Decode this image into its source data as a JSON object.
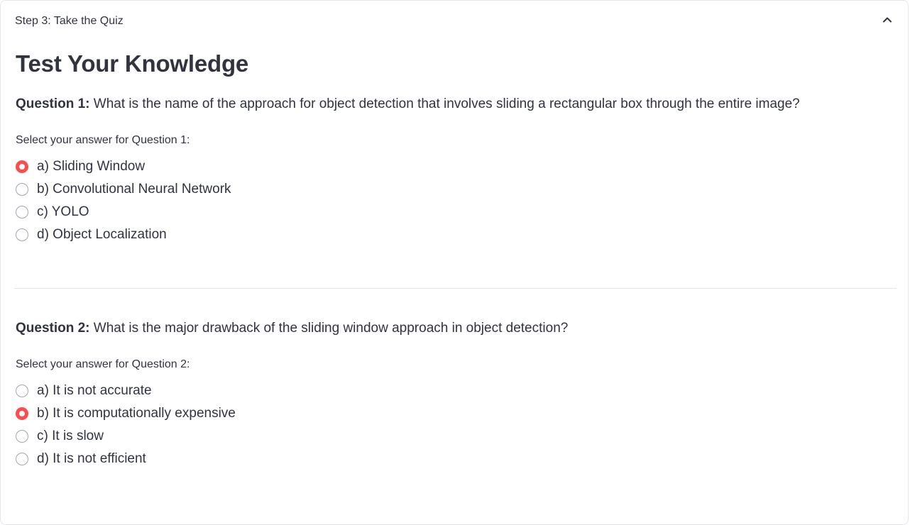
{
  "expander": {
    "title": "Step 3: Take the Quiz"
  },
  "page_title": "Test Your Knowledge",
  "questions": [
    {
      "label": "Question 1:",
      "text": " What is the name of the approach for object detection that involves sliding a rectangular box through the entire image?",
      "prompt": "Select your answer for Question 1:",
      "options": [
        {
          "text": "a) Sliding Window",
          "selected": true
        },
        {
          "text": "b) Convolutional Neural Network",
          "selected": false
        },
        {
          "text": "c) YOLO",
          "selected": false
        },
        {
          "text": "d) Object Localization",
          "selected": false
        }
      ]
    },
    {
      "label": "Question 2:",
      "text": " What is the major drawback of the sliding window approach in object detection?",
      "prompt": "Select your answer for Question 2:",
      "options": [
        {
          "text": "a) It is not accurate",
          "selected": false
        },
        {
          "text": "b) It is computationally expensive",
          "selected": true
        },
        {
          "text": "c) It is slow",
          "selected": false
        },
        {
          "text": "d) It is not efficient",
          "selected": false
        }
      ]
    }
  ],
  "colors": {
    "accent": "#ff4b4b",
    "text": "#31333f",
    "border": "#e6e6ea"
  },
  "icons": {
    "collapse": "chevron-up-icon"
  }
}
